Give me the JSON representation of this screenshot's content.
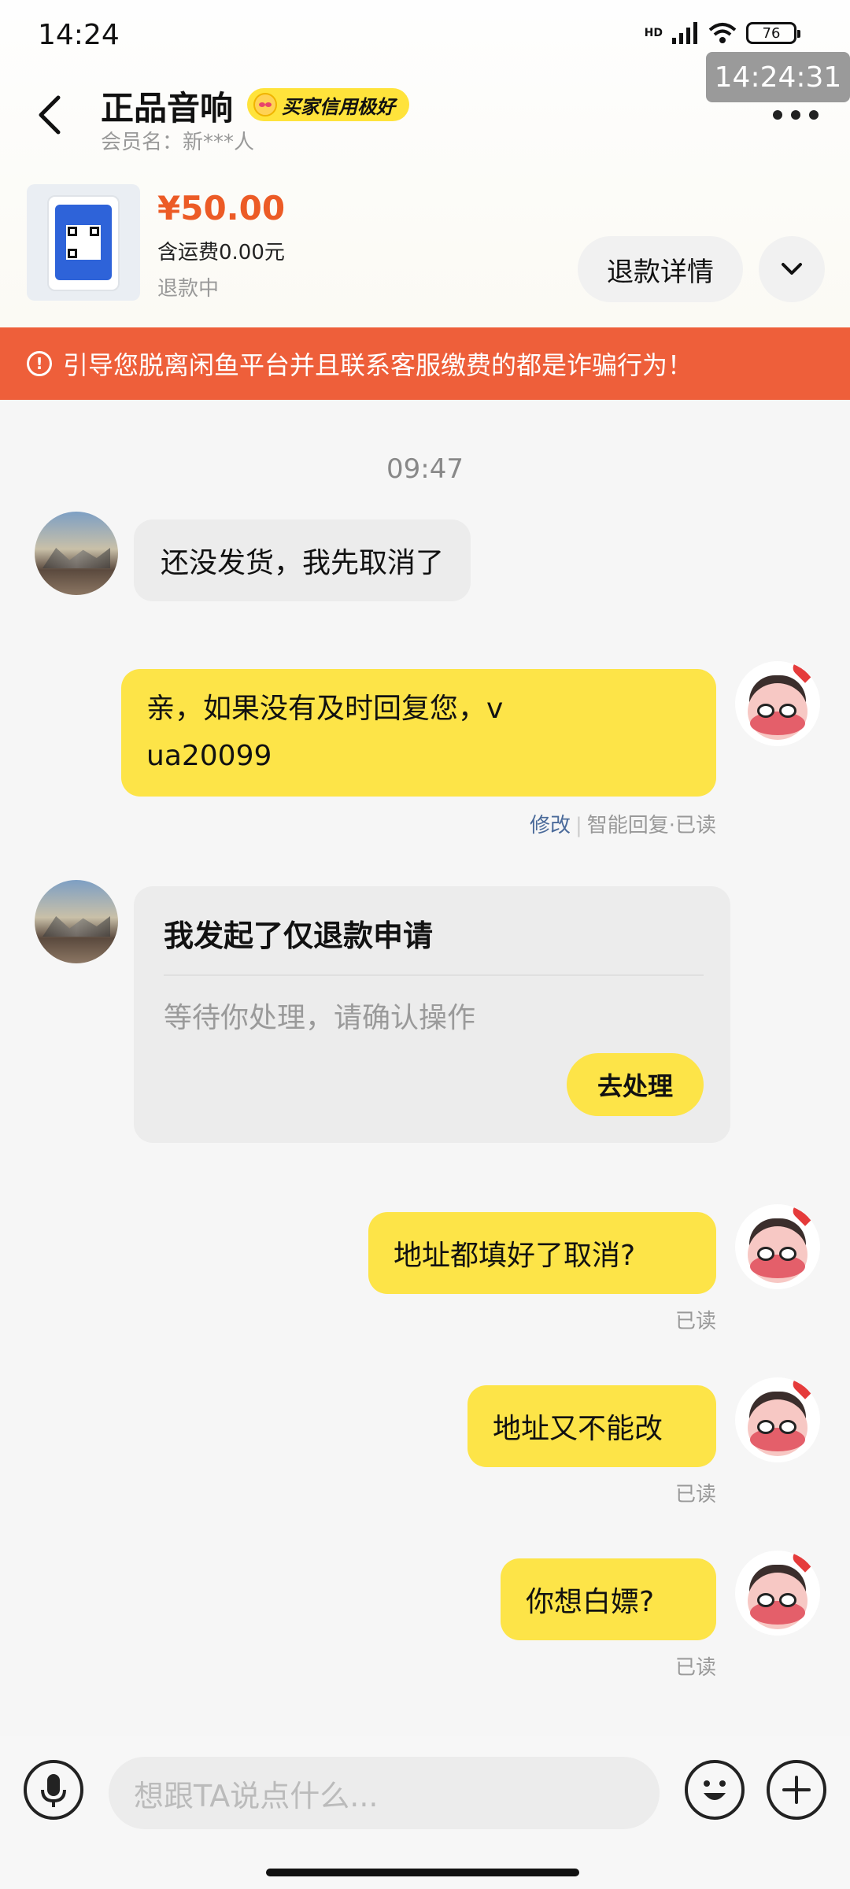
{
  "status_bar": {
    "time": "14:24",
    "network": "HD",
    "battery": "76"
  },
  "overlay_clock": "14:24:31",
  "header": {
    "title": "正品音响",
    "credit_badge": "买家信用极好",
    "member": "会员名：新***人"
  },
  "product": {
    "price": "¥50.00",
    "shipping": "含运费0.00元",
    "status": "退款中",
    "refund_button": "退款详情"
  },
  "warning": "引导您脱离闲鱼平台并且联系客服缴费的都是诈骗行为！",
  "chat": {
    "timestamp": "09:47",
    "msg1": "还没发货，我先取消了",
    "msg2_line1": "亲，如果没有及时回复您，v",
    "msg2_line2": "ua20099",
    "msg2_meta_edit": "修改",
    "msg2_meta_rest": "智能回复·已读",
    "card_title": "我发起了仅退款申请",
    "card_sub": "等待你处理，请确认操作",
    "card_button": "去处理",
    "msg3": "地址都填好了取消?",
    "msg3_meta": "已读",
    "msg4": "地址又不能改",
    "msg4_meta": "已读",
    "msg5": "你想白嫖?",
    "msg5_meta": "已读"
  },
  "input_bar": {
    "placeholder": "想跟TA说点什么..."
  },
  "colors": {
    "accent_yellow": "#fde448",
    "warning_orange": "#ee5f3a",
    "price_orange": "#ec5b26"
  }
}
